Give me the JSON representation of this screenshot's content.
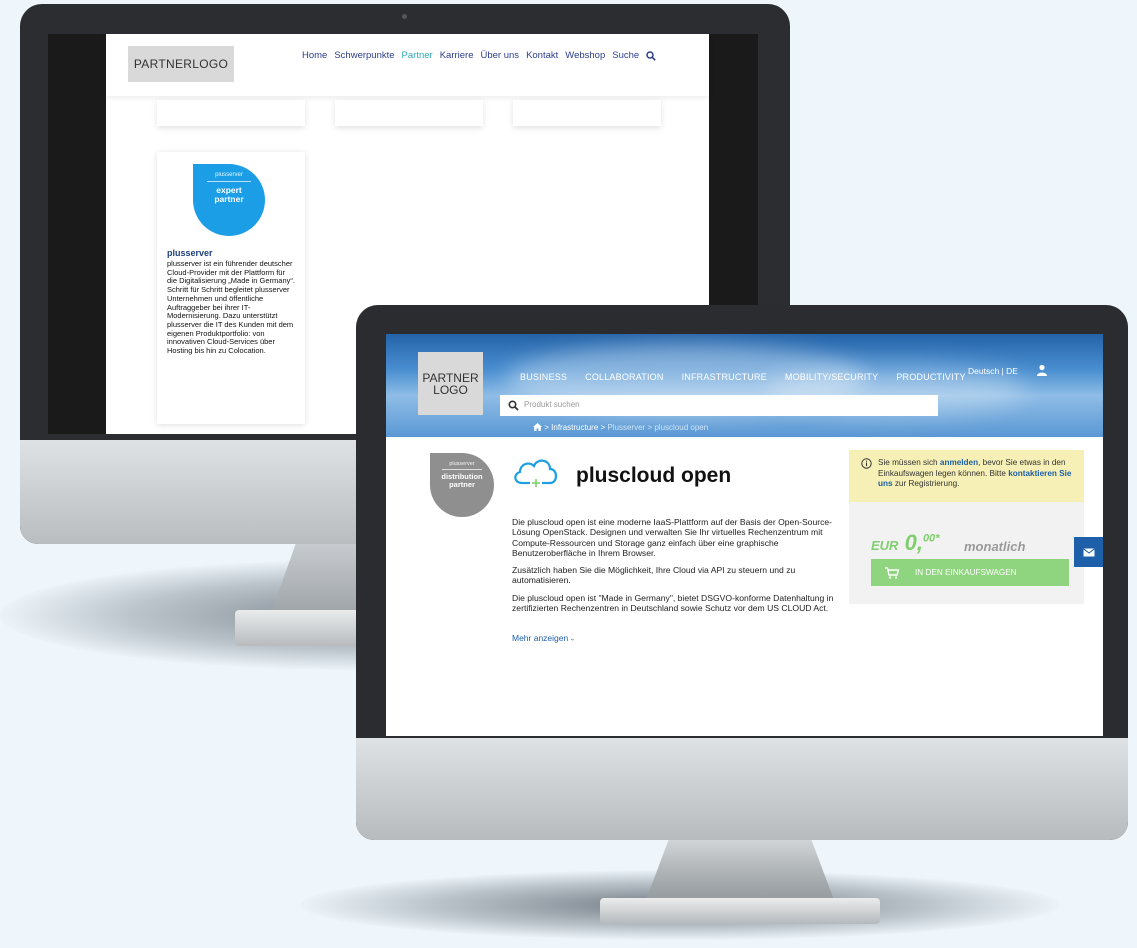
{
  "back_window": {
    "logo": "PARTNERLOGO",
    "nav": [
      "Home",
      "Schwerpunkte",
      "Partner",
      "Karriere",
      "Über uns",
      "Kontakt",
      "Webshop",
      "Suche"
    ],
    "active_nav": "Partner",
    "partner_card": {
      "badge_brand": "plusserver",
      "badge_line1": "expert",
      "badge_line2": "partner",
      "title": "plusserver",
      "description": "plusserver ist ein führender deutscher Cloud-Provider mit der Plattform für die Digitalisierung „Made in Germany“. Schritt für Schritt begleitet plusserver Unternehmen und öffentliche Auftraggeber bei ihrer IT-Modernisierung. Dazu unterstützt plusserver die IT des Kunden mit dem eigenen Produktportfolio: von innovativen Cloud-Services über Hosting bis hin zu Colocation."
    }
  },
  "front_window": {
    "logo_line1": "PARTNER",
    "logo_line2": "LOGO",
    "nav": [
      "BUSINESS",
      "COLLABORATION",
      "INFRASTRUCTURE",
      "MOBILITY/SECURITY",
      "PRODUCTIVITY"
    ],
    "language": "Deutsch | DE",
    "search_placeholder": "Produkt suchen",
    "breadcrumb": {
      "sep": ">",
      "items": [
        "Infrastructure",
        "Plusserver",
        "pluscloud open"
      ]
    },
    "badge": {
      "brand": "plusserver",
      "line1": "distribution",
      "line2": "partner"
    },
    "product_title": "pluscloud open",
    "paragraphs": [
      "Die pluscloud open ist eine moderne IaaS-Plattform auf der Basis der Open-Source-Lösung OpenStack. Designen und verwalten Sie Ihr virtuelles Rechenzentrum mit Compute-Ressourcen und Storage ganz einfach über eine graphische Benutzeroberfläche in Ihrem Browser.",
      "Zusätzlich haben Sie die Möglichkeit, Ihre Cloud via API zu steuern und zu automatisieren.",
      "Die pluscloud open ist \"Made in Germany\", bietet DSGVO-konforme Datenhaltung in zertifizierten Rechenzentren in Deutschland sowie Schutz vor dem US CLOUD Act."
    ],
    "more_link": "Mehr anzeigen",
    "more_chevron": "›",
    "notice": {
      "text1": "Sie müssen sich ",
      "link1": "anmelden",
      "text2": ", bevor Sie etwas in den Einkaufswagen legen können. Bitte ",
      "link2": "kontaktieren Sie uns",
      "text3": " zur Registrierung."
    },
    "price": {
      "currency": "EUR",
      "amount": "0,",
      "cents": "00",
      "asterisk": "*",
      "period": "monatlich"
    },
    "cart_button": "IN DEN EINKAUFSWAGEN",
    "colors": {
      "nav_blue": "#2c3e8c",
      "accent_teal": "#2fa8b5",
      "badge_blue": "#1b9ee6",
      "link_blue": "#1d5fa8",
      "price_green": "#7fcf6e",
      "button_green": "#8fd47e",
      "notice_yellow": "#f7f0b6"
    },
    "icons": [
      "home-icon",
      "search-icon",
      "user-icon",
      "info-icon",
      "cloud-icon",
      "cart-icon",
      "mail-icon"
    ]
  }
}
